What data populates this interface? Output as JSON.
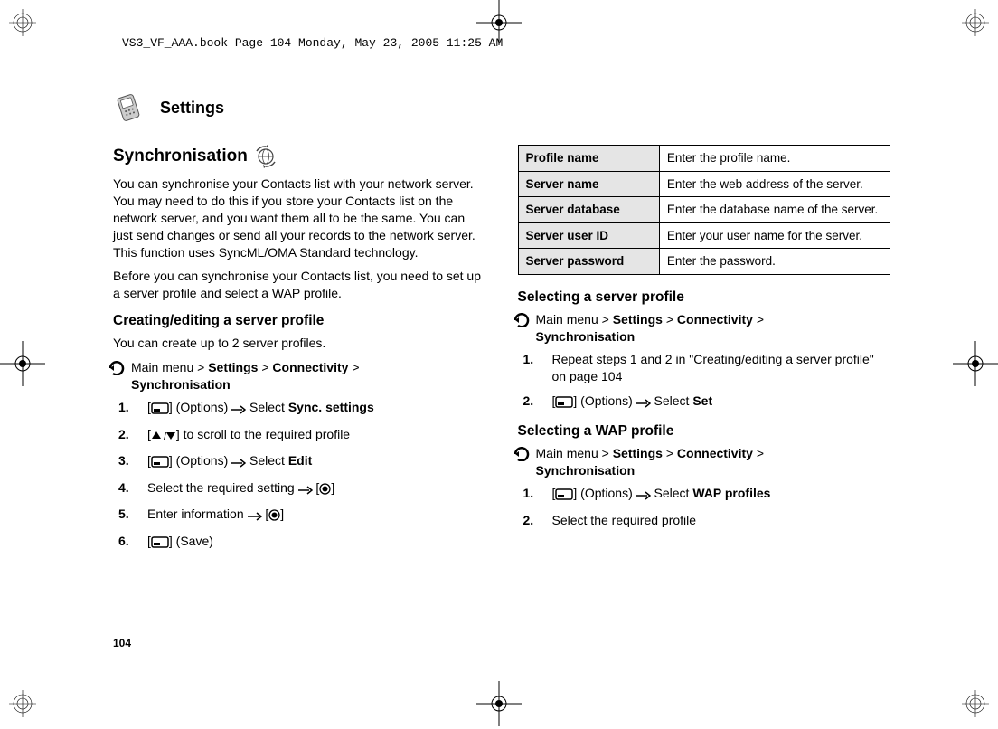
{
  "print_header": "VS3_VF_AAA.book  Page 104  Monday, May 23, 2005  11:25 AM",
  "section_title": "Settings",
  "page_number": "104",
  "left": {
    "title": "Synchronisation",
    "intro1": "You can synchronise your Contacts list with your network server. You may need to do this if you store your Contacts list on the network server, and you want them all to be the same. You can just send changes or send all your records to the network server. This function uses SyncML/OMA Standard technology.",
    "intro2": "Before you can synchronise your Contacts list, you need to set up a server profile and select a WAP profile.",
    "subsection1": "Creating/editing a server profile",
    "note1": "You can create up to 2 server profiles.",
    "nav_prefix": "Main menu > ",
    "nav_part1": "Settings",
    "nav_sep": " > ",
    "nav_part2": "Connectivity",
    "nav_part3": "Synchronisation",
    "step1_mid": " (Options) ",
    "step1_select": " Select ",
    "step1_bold": "Sync. settings",
    "step2_text": " to scroll to the required profile",
    "step3_mid": " (Options) ",
    "step3_select": " Select ",
    "step3_bold": "Edit",
    "step4_text": "Select the required setting ",
    "step5_text": "Enter information ",
    "step6_text": " (Save)"
  },
  "table": {
    "r1": {
      "label": "Profile name",
      "value": "Enter the profile name."
    },
    "r2": {
      "label": "Server name",
      "value": "Enter the web address of the server."
    },
    "r3": {
      "label": "Server database",
      "value": "Enter the database name of the server."
    },
    "r4": {
      "label": "Server user ID",
      "value": "Enter your user name for the server."
    },
    "r5": {
      "label": "Server password",
      "value": "Enter the password."
    }
  },
  "right": {
    "subsection1": "Selecting a server profile",
    "nav_prefix": "Main menu > ",
    "nav_part1": "Settings",
    "nav_sep": " > ",
    "nav_part2": "Connectivity",
    "nav_part3": "Synchronisation",
    "step1_text": "Repeat steps 1 and 2 in \"Creating/editing a server profile\" on page 104",
    "step2_mid": " (Options) ",
    "step2_select": " Select ",
    "step2_bold": "Set",
    "subsection2": "Selecting a WAP profile",
    "step3_mid": " (Options) ",
    "step3_select": " Select ",
    "step3_bold": "WAP profiles",
    "step4_text": "Select the required profile"
  }
}
